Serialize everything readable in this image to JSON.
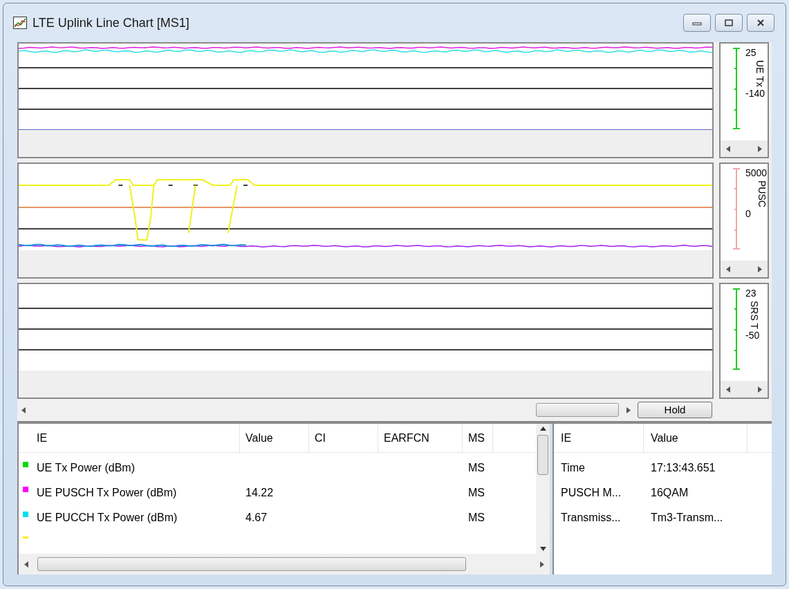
{
  "window": {
    "title": "LTE Uplink Line Chart [MS1]"
  },
  "charts": [
    {
      "axis_max": "25",
      "axis_label": "UE Tx",
      "axis_min": "-140"
    },
    {
      "axis_max": "5000",
      "axis_label": "PUSC",
      "axis_min": "0"
    },
    {
      "axis_max": "23",
      "axis_label": "SRS T",
      "axis_min": "-50"
    }
  ],
  "hold_button": "Hold",
  "ie_table": {
    "columns": [
      "IE",
      "Value",
      "CI",
      "EARFCN",
      "MS"
    ],
    "rows": [
      {
        "color": "#00dd00",
        "cells": [
          "UE Tx Power (dBm)",
          "",
          "",
          "",
          "MS"
        ]
      },
      {
        "color": "#ff00ff",
        "cells": [
          "UE PUSCH Tx Power (dBm)",
          "14.22",
          "",
          "",
          "MS"
        ]
      },
      {
        "color": "#00e0f0",
        "cells": [
          "UE PUCCH Tx Power (dBm)",
          "4.67",
          "",
          "",
          "MS"
        ]
      },
      {
        "color": "#ffee00"
      }
    ]
  },
  "detail_table": {
    "columns": [
      "IE",
      "Value"
    ],
    "rows": [
      {
        "cells": [
          "Time",
          "17:13:43.651"
        ]
      },
      {
        "cells": [
          "PUSCH M...",
          "16QAM"
        ]
      },
      {
        "cells": [
          "Transmiss...",
          "Tm3-Transm..."
        ]
      }
    ]
  }
}
